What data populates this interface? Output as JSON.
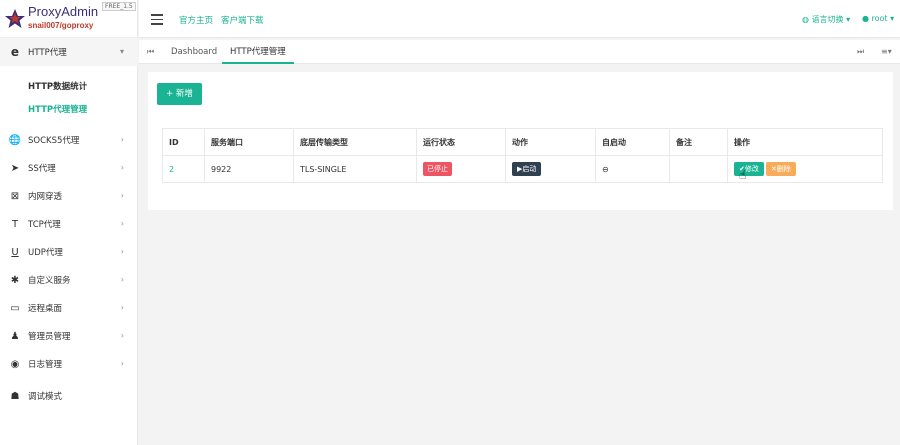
{
  "brand": {
    "name": "ProxyAdmin",
    "subtitle": "snail007/goproxy",
    "version": "FREE_1.5"
  },
  "sidebar": {
    "items": [
      {
        "label": "HTTP代理",
        "icon": "http-icon"
      },
      {
        "label": "SOCKS5代理",
        "icon": "globe-icon"
      },
      {
        "label": "SS代理",
        "icon": "send-icon"
      },
      {
        "label": "内网穿透",
        "icon": "expand-icon"
      },
      {
        "label": "TCP代理",
        "icon": "t-icon"
      },
      {
        "label": "UDP代理",
        "icon": "u-icon"
      },
      {
        "label": "自定义服务",
        "icon": "puzzle-icon"
      },
      {
        "label": "远程桌面",
        "icon": "desktop-icon"
      },
      {
        "label": "管理员管理",
        "icon": "user-icon"
      },
      {
        "label": "日志管理",
        "icon": "camera-icon"
      },
      {
        "label": "调试模式",
        "icon": "bug-icon"
      }
    ],
    "subitems": [
      {
        "label": "HTTP数据统计"
      },
      {
        "label": "HTTP代理管理"
      }
    ]
  },
  "topbar": {
    "links": [
      "官方主页",
      "客户端下载"
    ],
    "language": "语言切换",
    "user": "root"
  },
  "tabs": [
    "Dashboard",
    "HTTP代理管理"
  ],
  "toolbar": {
    "add_label": "+ 新增"
  },
  "table": {
    "headers": [
      "ID",
      "服务端口",
      "底层传输类型",
      "运行状态",
      "动作",
      "自启动",
      "备注",
      "操作"
    ],
    "rows": [
      {
        "id": "2",
        "port": "9922",
        "transport": "TLS-SINGLE",
        "status": "已停止",
        "action": "▶启动",
        "autostart": "⊖",
        "remark": "",
        "edit": "✔修改",
        "delete": "✕删除"
      }
    ]
  },
  "colors": {
    "accent": "#1ab394",
    "danger": "#ed5565",
    "dark": "#2f4050",
    "warning": "#f8ac59"
  }
}
